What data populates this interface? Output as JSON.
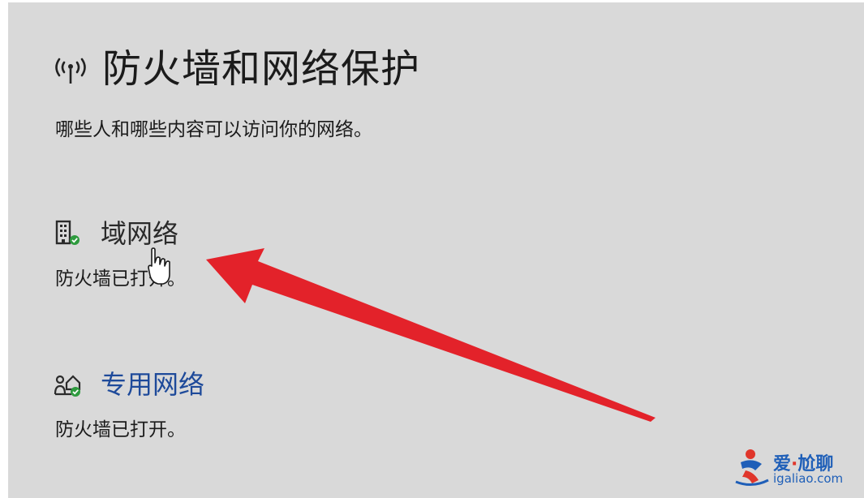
{
  "header": {
    "title": "防火墙和网络保护",
    "icon": "signal-antenna-icon",
    "subtitle": "哪些人和哪些内容可以访问你的网络。"
  },
  "sections": [
    {
      "name": "域网络",
      "status": "防火墙已打开。",
      "icon": "domain-network-icon",
      "badge_color": "#2e9b3e",
      "hovered": true
    },
    {
      "name": "专用网络",
      "status": "防火墙已打开。",
      "icon": "private-network-icon",
      "badge_color": "#2e9b3e",
      "link_color": "#1e4a9a"
    }
  ],
  "colors": {
    "background": "#d9d9d9",
    "arrow": "#e3222a"
  },
  "watermark": {
    "cn_text_1": "爱",
    "separator": "·",
    "cn_text_2": "尬聊",
    "url": "igaliao.com"
  }
}
